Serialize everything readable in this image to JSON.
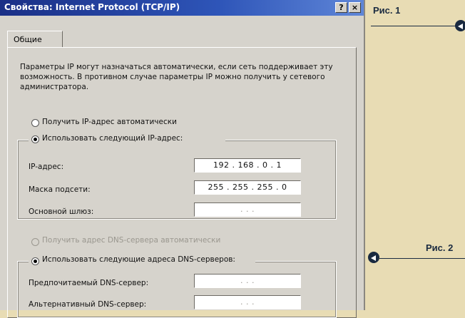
{
  "window": {
    "title": "Свойства: Internet Protocol (TCP/IP)",
    "help_button": "?",
    "close_button": "×"
  },
  "tabs": [
    {
      "label": "Общие",
      "active": true
    }
  ],
  "description": "Параметры IP могут назначаться автоматически, если сеть поддерживает эту возможность. В противном случае параметры IP можно получить у сетевого администратора.",
  "ip": {
    "auto_label": "Получить IP-адрес автоматически",
    "auto_selected": false,
    "manual_label": "Использовать следующий IP-адрес:",
    "manual_selected": true,
    "fields": [
      {
        "label": "IP-адрес:",
        "value": "192 . 168 .  0  .  1"
      },
      {
        "label": "Маска подсети:",
        "value": "255 . 255 . 255 .  0"
      },
      {
        "label": "Основной шлюз:",
        "value": ".     .     ."
      }
    ]
  },
  "dns": {
    "auto_label": "Получить адрес DNS-сервера автоматически",
    "auto_enabled": false,
    "manual_label": "Использовать следующие адреса DNS-серверов:",
    "manual_selected": true,
    "fields": [
      {
        "label": "Предпочитаемый DNS-сервер:",
        "value": ".     .     ."
      },
      {
        "label": "Альтернативный DNS-сервер:",
        "value": ".     .     ."
      }
    ]
  },
  "annotations": {
    "fig1": "Рис. 1",
    "fig2": "Рис. 2"
  },
  "colors": {
    "titlebar_start": "#1a2f86",
    "titlebar_end": "#5f86d8",
    "page_bg": "#e8dcb4",
    "annotation": "#1a2a40"
  }
}
